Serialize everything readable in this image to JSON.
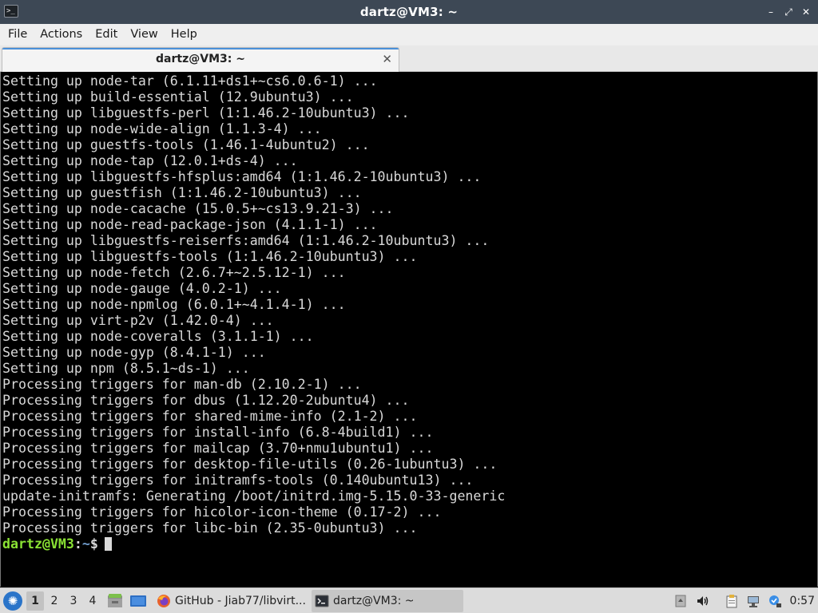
{
  "window": {
    "title": "dartz@VM3: ~",
    "app_icon": "terminal-icon",
    "controls": {
      "minimize": "–",
      "restore": "⤢",
      "close": "✕"
    }
  },
  "menubar": {
    "items": [
      "File",
      "Actions",
      "Edit",
      "View",
      "Help"
    ]
  },
  "tabs": [
    {
      "label": "dartz@VM3: ~",
      "close": "✕",
      "active": true
    }
  ],
  "terminal": {
    "lines": [
      "Setting up node-tar (6.1.11+ds1+~cs6.0.6-1) ...",
      "Setting up build-essential (12.9ubuntu3) ...",
      "Setting up libguestfs-perl (1:1.46.2-10ubuntu3) ...",
      "Setting up node-wide-align (1.1.3-4) ...",
      "Setting up guestfs-tools (1.46.1-4ubuntu2) ...",
      "Setting up node-tap (12.0.1+ds-4) ...",
      "Setting up libguestfs-hfsplus:amd64 (1:1.46.2-10ubuntu3) ...",
      "Setting up guestfish (1:1.46.2-10ubuntu3) ...",
      "Setting up node-cacache (15.0.5+~cs13.9.21-3) ...",
      "Setting up node-read-package-json (4.1.1-1) ...",
      "Setting up libguestfs-reiserfs:amd64 (1:1.46.2-10ubuntu3) ...",
      "Setting up libguestfs-tools (1:1.46.2-10ubuntu3) ...",
      "Setting up node-fetch (2.6.7+~2.5.12-1) ...",
      "Setting up node-gauge (4.0.2-1) ...",
      "Setting up node-npmlog (6.0.1+~4.1.4-1) ...",
      "Setting up virt-p2v (1.42.0-4) ...",
      "Setting up node-coveralls (3.1.1-1) ...",
      "Setting up node-gyp (8.4.1-1) ...",
      "Setting up npm (8.5.1~ds-1) ...",
      "Processing triggers for man-db (2.10.2-1) ...",
      "Processing triggers for dbus (1.12.20-2ubuntu4) ...",
      "Processing triggers for shared-mime-info (2.1-2) ...",
      "Processing triggers for install-info (6.8-4build1) ...",
      "Processing triggers for mailcap (3.70+nmu1ubuntu1) ...",
      "Processing triggers for desktop-file-utils (0.26-1ubuntu3) ...",
      "Processing triggers for initramfs-tools (0.140ubuntu13) ...",
      "update-initramfs: Generating /boot/initrd.img-5.15.0-33-generic",
      "Processing triggers for hicolor-icon-theme (0.17-2) ...",
      "Processing triggers for libc-bin (2.35-0ubuntu3) ..."
    ],
    "prompt": {
      "user": "dartz@VM3",
      "sep": ":",
      "path": "~",
      "symbol": "$"
    },
    "colors": {
      "user": "#8ae234",
      "path": "#729fcf",
      "text": "#d9d9d9"
    }
  },
  "taskbar": {
    "start_icon": "start-menu-icon",
    "desktops": [
      "1",
      "2",
      "3",
      "4"
    ],
    "active_desktop": "1",
    "launchers": [
      "file-manager-icon",
      "show-desktop-icon"
    ],
    "tasks": [
      {
        "label": "GitHub - Jiab77/libvirt...",
        "icon": "firefox-icon",
        "active": false
      },
      {
        "label": "dartz@VM3: ~",
        "icon": "terminal-icon",
        "active": true
      }
    ],
    "tray": [
      "removable-media-icon",
      "volume-icon",
      "clipboard-icon",
      "network-icon",
      "update-notifier-icon"
    ],
    "clock": "0:57"
  }
}
